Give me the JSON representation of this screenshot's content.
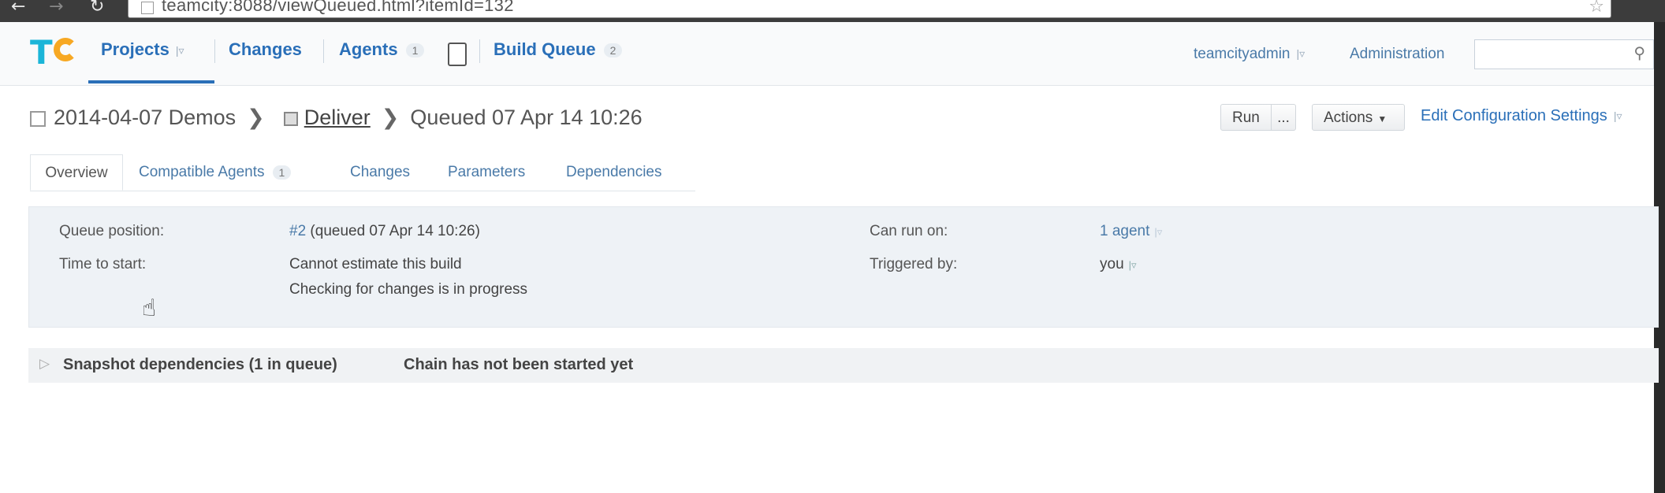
{
  "browser": {
    "back_icon": "back-arrow-icon",
    "forward_icon": "forward-arrow-icon",
    "reload_icon": "reload-icon",
    "url": "teamcity:8088/viewQueued.html?itemId=132"
  },
  "header": {
    "nav": {
      "projects": "Projects",
      "changes": "Changes",
      "agents": "Agents",
      "agents_count": "1",
      "build_queue": "Build Queue",
      "build_queue_count": "2"
    },
    "user": "teamcityadmin",
    "administration": "Administration",
    "search_placeholder": ""
  },
  "breadcrumb": {
    "project": "2014-04-07 Demos",
    "configuration": "Deliver",
    "current": "Queued 07 Apr 14 10:26"
  },
  "toolbar": {
    "run": "Run",
    "run_more": "...",
    "actions": "Actions",
    "edit_config": "Edit Configuration Settings"
  },
  "tabs": {
    "overview": "Overview",
    "compatible_agents": "Compatible Agents",
    "compatible_agents_count": "1",
    "changes": "Changes",
    "parameters": "Parameters",
    "dependencies": "Dependencies"
  },
  "info": {
    "queue_position_label": "Queue position:",
    "queue_position_link": "#2",
    "queue_position_value": "(queued 07 Apr 14 10:26)",
    "time_to_start_label": "Time to start:",
    "time_to_start_line1": "Cannot estimate this build",
    "time_to_start_line2": "Checking for changes is in progress",
    "can_run_on_label": "Can run on:",
    "can_run_on_value": "1 agent",
    "triggered_by_label": "Triggered by:",
    "triggered_by_value": "you"
  },
  "snapshot": {
    "title": "Snapshot dependencies (1 in queue)",
    "status": "Chain has not been started yet"
  },
  "colors": {
    "link": "#2a6fb8",
    "logo_blue": "#1bb5d8",
    "logo_orange": "#f7a823",
    "panel": "#eef2f6"
  }
}
